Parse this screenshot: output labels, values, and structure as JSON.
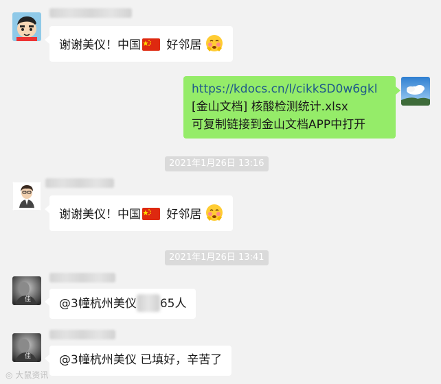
{
  "chat": {
    "messages": [
      {
        "sender": "left",
        "text_before": "谢谢美仪！中国",
        "text_after": "好邻居"
      },
      {
        "sender": "right",
        "lines": [
          "https://kdocs.cn/l/cikkSD0w6gkl",
          "[金山文档] 核酸检测统计.xlsx",
          "可复制链接到金山文档APP中打开"
        ]
      },
      {
        "sender": "left",
        "text_before": "谢谢美仪！中国",
        "text_after": "好邻居"
      },
      {
        "sender": "left",
        "text_before": "@3幢杭州美仪",
        "text_after": "65人"
      },
      {
        "sender": "left",
        "text": "@3幢杭州美仪 已填好，辛苦了"
      }
    ],
    "timestamps": [
      "2021年1月26日 13:16",
      "2021年1月26日 13:41"
    ]
  },
  "watermark": "大鼠资讯",
  "icons": {
    "flag": "china-flag-icon",
    "emoji": "blushing-face-emoji-icon"
  },
  "colors": {
    "background": "#f2f2f2",
    "bubble_self": "#95ec69",
    "bubble_other": "#ffffff",
    "timestamp_bg": "#dadada"
  }
}
